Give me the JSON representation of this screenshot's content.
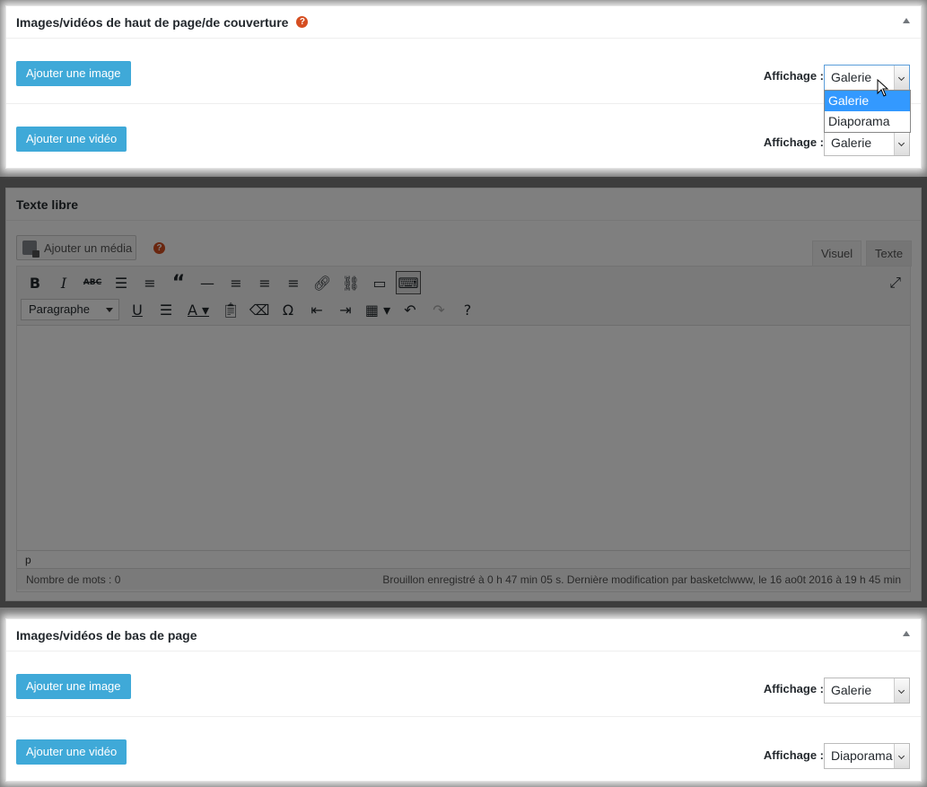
{
  "top_box": {
    "title": "Images/vidéos de haut de page/de couverture",
    "help_glyph": "?",
    "rows": [
      {
        "button": "Ajouter une image",
        "label": "Affichage :",
        "value": "Galerie"
      },
      {
        "button": "Ajouter une vidéo",
        "label": "Affichage :",
        "value": "Galerie"
      }
    ],
    "dropdown_options": [
      "Galerie",
      "Diaporama"
    ],
    "dropdown_selected": "Galerie"
  },
  "editor_box": {
    "title": "Texte libre",
    "add_media": "Ajouter un média",
    "help_glyph": "?",
    "tabs": {
      "visual": "Visuel",
      "text": "Texte"
    },
    "format_select": "Paragraphe",
    "path": "p",
    "word_count": "Nombre de mots : 0",
    "status": "Brouillon enregistré à 0 h 47 min 05 s. Dernière modification par basketclwww, le 16 ao0t 2016 à 19 h 45 min"
  },
  "bottom_box": {
    "title": "Images/vidéos de bas de page",
    "rows": [
      {
        "button": "Ajouter une image",
        "label": "Affichage :",
        "value": "Galerie"
      },
      {
        "button": "Ajouter une vidéo",
        "label": "Affichage :",
        "value": "Diaporama"
      }
    ]
  },
  "colors": {
    "button_blue": "#3fa9d8",
    "help_orange": "#d54e21",
    "dropdown_highlight": "#3399ff"
  }
}
